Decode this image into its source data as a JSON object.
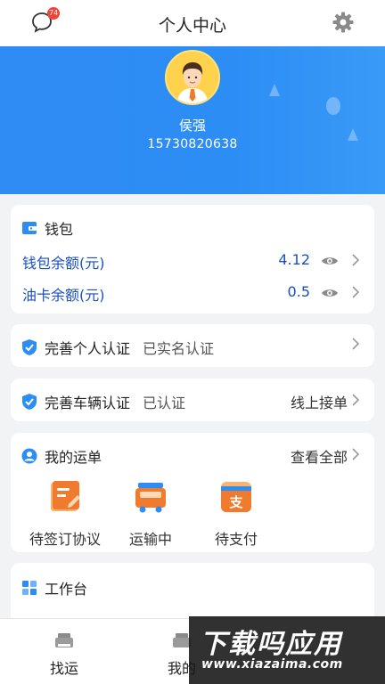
{
  "header": {
    "title": "个人中心",
    "message_badge": "74",
    "message_icon": "chat-bubble-icon",
    "settings_icon": "gear-icon"
  },
  "profile": {
    "name": "侯强",
    "phone": "15730820638",
    "avatar_icon": "user-avatar-icon"
  },
  "wallet": {
    "title": "钱包",
    "rows": [
      {
        "label": "钱包余额(元)",
        "value": "4.12"
      },
      {
        "label": "油卡余额(元)",
        "value": "0.5"
      }
    ]
  },
  "personal_auth": {
    "title": "完善个人认证",
    "status": "已实名认证"
  },
  "vehicle_auth": {
    "title": "完善车辆认证",
    "status": "已认证",
    "link": "线上接单"
  },
  "orders": {
    "title": "我的运单",
    "view_all": "查看全部",
    "items": [
      {
        "label": "待签订协议",
        "icon": "contract-icon"
      },
      {
        "label": "运输中",
        "icon": "truck-icon"
      },
      {
        "label": "待支付",
        "icon": "payment-icon"
      }
    ]
  },
  "workbench": {
    "title": "工作台"
  },
  "tabs": [
    {
      "label": "找运",
      "icon": "truck-tab-icon"
    },
    {
      "label": "我的",
      "icon": "profile-tab-icon"
    }
  ],
  "watermark": {
    "main": "下载吗应用",
    "sub": "www.xiazaima.com"
  },
  "colors": {
    "primary": "#2c8df5",
    "value_text": "#1a4fc4",
    "badge": "#f04438"
  }
}
